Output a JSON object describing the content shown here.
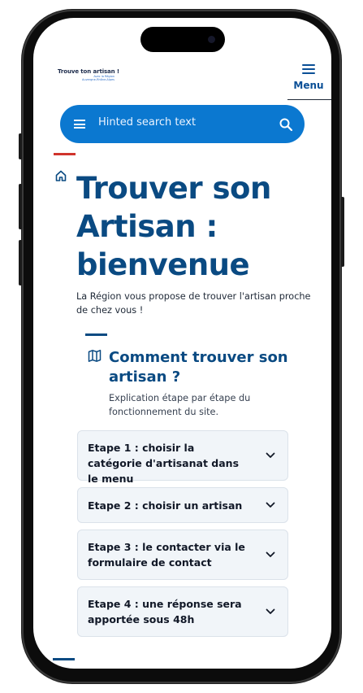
{
  "header": {
    "logo_title": "Trouve ton artisan !",
    "logo_line2": "Avec la Région",
    "logo_line3": "Auvergne-Rhône-Alpes",
    "menu_label": "Menu"
  },
  "search": {
    "placeholder": "Hinted search text"
  },
  "hero": {
    "title": "Trouver son Artisan : bienvenue",
    "intro": "La Région vous propose de trouver l'artisan proche de chez vous !"
  },
  "section": {
    "heading": "Comment trouver son artisan ?",
    "subheading": "Explication étape par étape du fonctionnement du site."
  },
  "steps": [
    {
      "label": "Etape 1 : choisir la catégorie d'artisanat dans le menu"
    },
    {
      "label": "Etape 2 : choisir un artisan"
    },
    {
      "label": "Etape 3 : le contacter via le formulaire de contact"
    },
    {
      "label": "Etape 4 : une réponse sera apportée sous 48h"
    }
  ],
  "colors": {
    "primary": "#0a4a82",
    "search_bg": "#0b78d0",
    "accent_red": "#d0342c",
    "accordion_bg": "#f1f5f9"
  },
  "icons": [
    "home-icon",
    "map-icon",
    "hamburger-icon",
    "search-icon",
    "chevron-down-icon"
  ]
}
